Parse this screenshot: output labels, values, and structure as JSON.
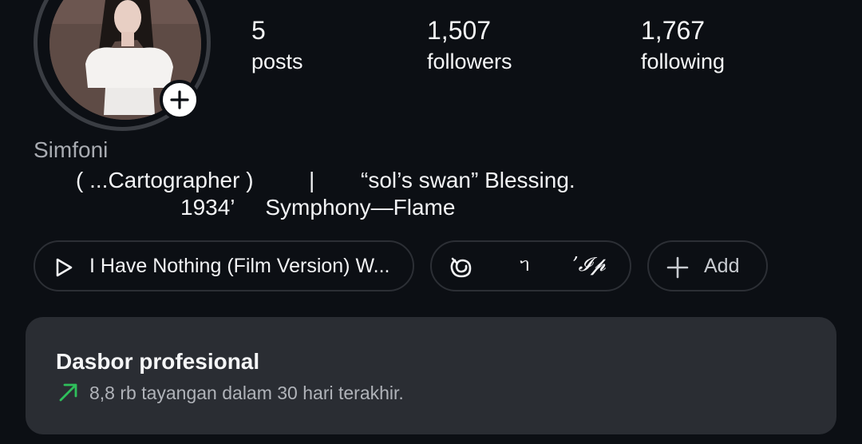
{
  "profile": {
    "name": "Simfoni",
    "bio_line_1a": "( ...Cartographer )",
    "bio_sep": "|",
    "bio_line_1b": "“sol’s swan” Blessing.",
    "bio_line_2": "1934’     Symphony—Flame"
  },
  "stats": [
    {
      "value": "5",
      "label": "posts"
    },
    {
      "value": "1,507",
      "label": "followers"
    },
    {
      "value": "1,767",
      "label": "following"
    }
  ],
  "pills": {
    "music": "I Have Nothing (Film Version) W...",
    "links_glyph_1": "ᥐ",
    "links_glyph_2": "’𝓘𝓹",
    "add": "Add"
  },
  "dashboard": {
    "title": "Dasbor profesional",
    "subtitle": "8,8 rb tayangan dalam 30 hari terakhir."
  },
  "colors": {
    "background": "#0c0f14",
    "card": "#2a2d33",
    "trend_green": "#2fbf5b"
  },
  "icons": [
    "add-story-icon",
    "play-icon",
    "threads-icon",
    "plus-icon",
    "trend-up-icon"
  ]
}
